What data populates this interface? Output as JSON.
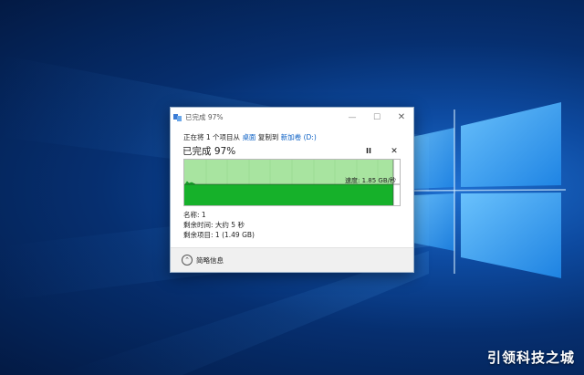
{
  "desktop": {
    "watermark": "引领科技之城"
  },
  "dialog": {
    "title": "已完成 97%",
    "status": {
      "prefix": "正在将 1 个项目从",
      "source": "桌面",
      "middle": "复制到",
      "destination": "新加卷 (D:)"
    },
    "percent_text": "已完成 97%",
    "progress_fraction": 0.97,
    "speed": "速度: 1.85 GB/秒",
    "name_line": "名称: 1",
    "time_left_line": "剩余时间: 大约 5 秒",
    "items_left_line": "剩余项目: 1 (1.49 GB)",
    "less_details_label": "简略信息",
    "pause_glyph": "II",
    "cancel_glyph": "✕",
    "colors": {
      "graph_fill": "#a8e4a0",
      "graph_speed": "#16b12a",
      "link": "#0a5fc4"
    }
  }
}
